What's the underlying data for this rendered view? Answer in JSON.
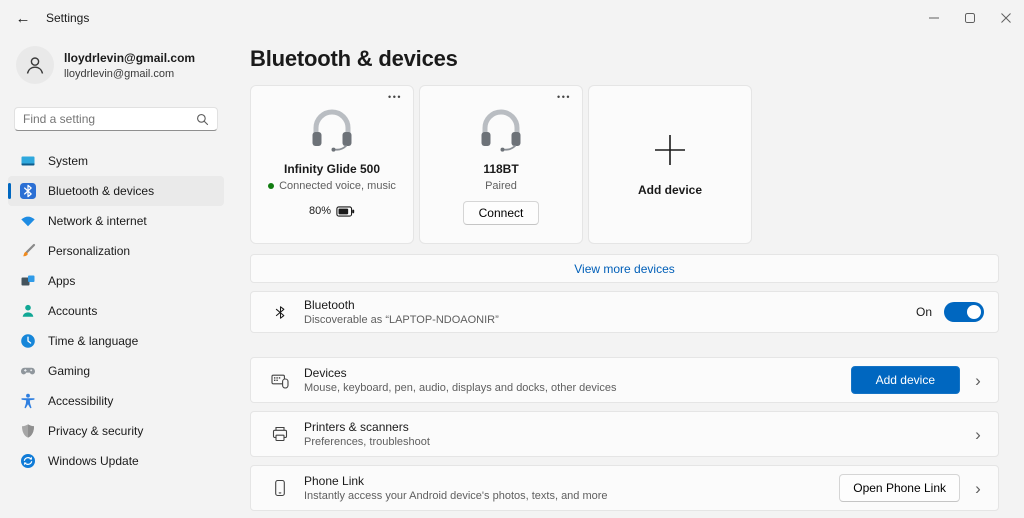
{
  "titlebar": {
    "title": "Settings"
  },
  "profile": {
    "name": "lloydrlevin@gmail.com",
    "email": "lloydrlevin@gmail.com"
  },
  "search": {
    "placeholder": "Find a setting"
  },
  "sidebar": {
    "items": [
      {
        "label": "System",
        "icon": "system-icon"
      },
      {
        "label": "Bluetooth & devices",
        "icon": "bluetooth-icon",
        "selected": true
      },
      {
        "label": "Network & internet",
        "icon": "network-icon"
      },
      {
        "label": "Personalization",
        "icon": "personalization-icon"
      },
      {
        "label": "Apps",
        "icon": "apps-icon"
      },
      {
        "label": "Accounts",
        "icon": "accounts-icon"
      },
      {
        "label": "Time & language",
        "icon": "time-language-icon"
      },
      {
        "label": "Gaming",
        "icon": "gaming-icon"
      },
      {
        "label": "Accessibility",
        "icon": "accessibility-icon"
      },
      {
        "label": "Privacy & security",
        "icon": "privacy-security-icon"
      },
      {
        "label": "Windows Update",
        "icon": "windows-update-icon"
      }
    ]
  },
  "page": {
    "title": "Bluetooth & devices"
  },
  "device_cards": {
    "cards": [
      {
        "name": "Infinity Glide 500",
        "status": "Connected voice, music",
        "battery": "80%"
      },
      {
        "name": "118BT",
        "status": "Paired",
        "action": "Connect"
      }
    ],
    "add_label": "Add device",
    "view_more": "View more devices"
  },
  "bluetooth": {
    "title": "Bluetooth",
    "subtitle": "Discoverable as “LAPTOP-NDOAONIR”",
    "toggle_label": "On",
    "toggle_state": "on"
  },
  "rows": [
    {
      "title": "Devices",
      "subtitle": "Mouse, keyboard, pen, audio, displays and docks, other devices",
      "button": "Add device"
    },
    {
      "title": "Printers & scanners",
      "subtitle": "Preferences, troubleshoot"
    },
    {
      "title": "Phone Link",
      "subtitle": "Instantly access your Android device's photos, texts, and more",
      "button": "Open Phone Link"
    }
  ],
  "icons": {
    "back": "←",
    "more": "•••",
    "chevron": "›"
  },
  "colors": {
    "accent": "#0067c0",
    "link": "#005fb8",
    "status_green": "#107c10"
  }
}
